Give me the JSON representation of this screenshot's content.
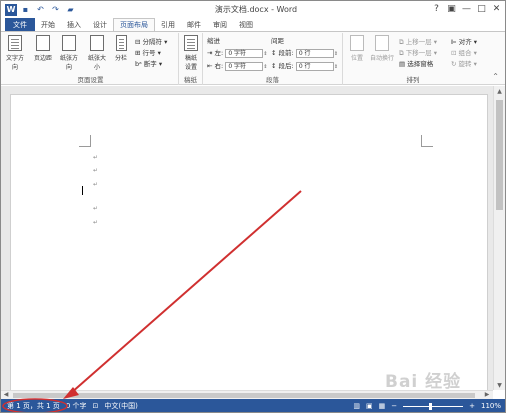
{
  "titlebar": {
    "title": "演示文档.docx - Word",
    "logo": "W",
    "quick_access": [
      "save-icon",
      "undo-icon",
      "redo-icon",
      "open-icon"
    ],
    "controls": {
      "help": "?",
      "restore": "▣",
      "minimize": "—",
      "maximize": "□",
      "close": "✕"
    }
  },
  "tabs": [
    "文件",
    "开始",
    "插入",
    "设计",
    "页面布局",
    "引用",
    "邮件",
    "审阅",
    "视图"
  ],
  "ribbon": {
    "page_setup": {
      "label": "页面设置",
      "buttons": [
        "文字方向",
        "页边距",
        "纸张方向",
        "纸张大小",
        "分栏"
      ],
      "small": [
        "分隔符",
        "行号",
        "断字"
      ]
    },
    "draft": {
      "label": "稿纸",
      "button_line1": "稿纸",
      "button_line2": "设置"
    },
    "paragraph": {
      "label": "段落",
      "indent_title": "缩进",
      "spacing_title": "间距",
      "left_label": "左:",
      "left_value": "0 字符",
      "right_label": "右:",
      "right_value": "0 字符",
      "before_label": "段前:",
      "before_value": "0 行",
      "after_label": "段后:",
      "after_value": "0 行"
    },
    "arrange": {
      "label": "排列",
      "position": "位置",
      "wrap": "自动换行",
      "bring_forward": "上移一层",
      "send_backward": "下移一层",
      "selection_pane": "选择窗格",
      "align": "对齐",
      "group": "组合",
      "rotate": "旋转"
    }
  },
  "document": {
    "paragraph_marks": [
      "↵",
      "↵",
      "↵",
      "↵",
      "↵"
    ]
  },
  "statusbar": {
    "page": "第 1 页，共 1 页",
    "words": "0 个字",
    "language": "中文(中国)",
    "zoom": "110%",
    "zoom_minus": "−",
    "zoom_plus": "+"
  },
  "watermark": "Bai 经验",
  "colors": {
    "accent": "#2b579a",
    "arrow": "#d03030"
  }
}
